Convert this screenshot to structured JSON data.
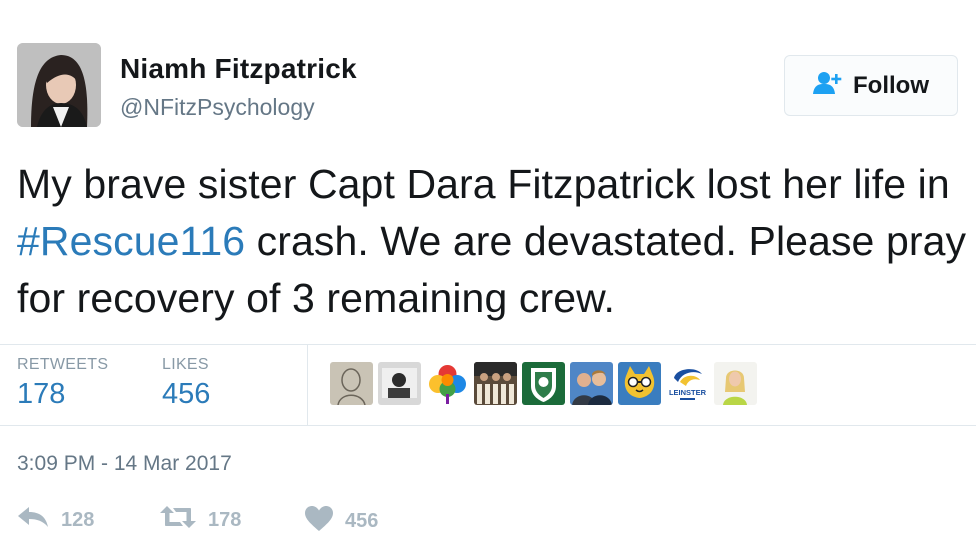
{
  "user": {
    "name": "Niamh Fitzpatrick",
    "handle": "@NFitzPsychology"
  },
  "follow_button": {
    "label": "Follow"
  },
  "tweet": {
    "text_before": "My brave sister Capt Dara Fitzpatrick lost her life in ",
    "hashtag": "#Rescue116",
    "text_after": " crash. We are devastated. Please pray for recovery of 3 remaining crew."
  },
  "stats": {
    "retweets_label": "RETWEETS",
    "retweets_value": "178",
    "likes_label": "LIKES",
    "likes_value": "456"
  },
  "likers": [
    "liker-avatar-sketch",
    "liker-avatar-photo",
    "liker-avatar-rainbow-shamrock",
    "liker-avatar-group",
    "liker-avatar-crest",
    "liker-avatar-couple",
    "liker-avatar-cat",
    "liker-avatar-leinster",
    "liker-avatar-woman"
  ],
  "leinster_text": "LEINSTER",
  "timestamp": "3:09 PM - 14 Mar 2017",
  "actions": {
    "reply_count": "128",
    "retweet_count": "178",
    "like_count": "456"
  },
  "colors": {
    "link": "#2b7bb9",
    "muted": "#657786",
    "icon": "#aab8c2",
    "follow_icon": "#1da1f2"
  }
}
